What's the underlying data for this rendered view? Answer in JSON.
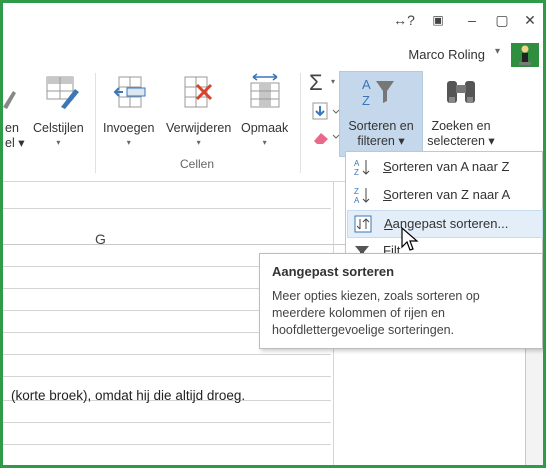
{
  "titlebar": {
    "help_icon": "↔?",
    "restore_ribbon_icon": "▣",
    "minimize": "–",
    "maximize": "▢",
    "close": "✕"
  },
  "user": {
    "name": "Marco Roling",
    "caret": "▾"
  },
  "ribbon": {
    "partial_left_label_1": "en",
    "partial_left_label_2": "el ▾",
    "celstijlen": "Celstijlen",
    "invoegen": "Invoegen",
    "verwijderen": "Verwijderen",
    "opmaak": "Opmaak",
    "cellen_group": "Cellen",
    "sort_filter_line1": "Sorteren en",
    "sort_filter_line2": "filteren ▾",
    "find_select_line1": "Zoeken en",
    "find_select_line2": "selecteren ▾",
    "caret": "▾",
    "sigma": "Σ",
    "colors": {
      "selected_bg": "#c5d8eb",
      "accent_blue": "#3a76b8",
      "delete_red": "#d9432b",
      "frame_green": "#2f9a48"
    }
  },
  "sheet": {
    "column_label": "G",
    "cell_text": "(korte broek), omdat hij die altijd droeg."
  },
  "menu": {
    "items": [
      {
        "pre": "",
        "u": "S",
        "post": "orteren van A naar Z",
        "icon": "sort-a-z-icon"
      },
      {
        "pre": "",
        "u": "S",
        "post": "orteren van Z naar A",
        "icon": "sort-z-a-icon"
      },
      {
        "pre": "",
        "u": "A",
        "post": "angepast sorteren...",
        "icon": "custom-sort-icon"
      },
      {
        "pre": "",
        "u": "",
        "post": "Filt",
        "icon": "filter-icon"
      }
    ]
  },
  "tooltip": {
    "title": "Aangepast sorteren",
    "body": "Meer opties kiezen, zoals sorteren op meerdere kolommen of rijen en hoofdlettergevoelige sorteringen."
  }
}
